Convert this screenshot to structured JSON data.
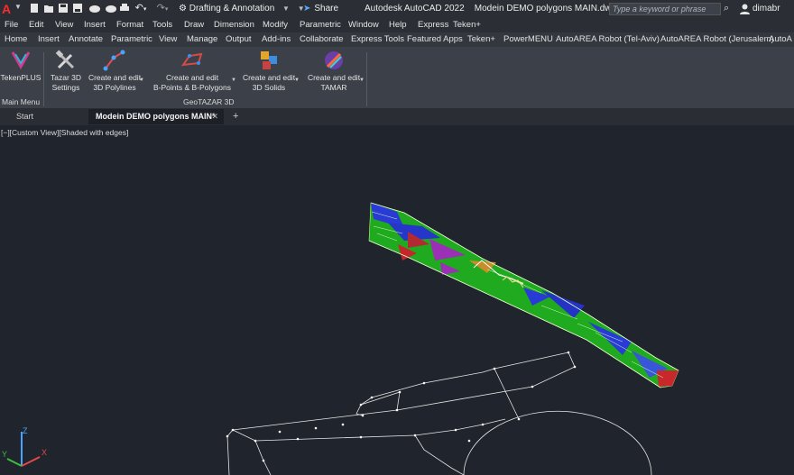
{
  "title_bar": {
    "logo_letter": "A",
    "workspace": "Drafting & Annotation",
    "share_label": "Share",
    "app_title": "Autodesk AutoCAD 2022",
    "file_name": "Modein DEMO polygons MAIN.dwg",
    "search_placeholder": "Type a keyword or phrase",
    "user": "dimabr",
    "icons": [
      "new-file-icon",
      "open-folder-icon",
      "save-icon",
      "save-as-icon",
      "print-icon",
      "undo-icon",
      "redo-icon",
      "gear-icon",
      "share-icon",
      "search-icon",
      "user-icon"
    ]
  },
  "menu_bar": [
    "File",
    "Edit",
    "View",
    "Insert",
    "Format",
    "Tools",
    "Draw",
    "Dimension",
    "Modify",
    "Parametric",
    "Window",
    "Help",
    "Express",
    "Teken+"
  ],
  "ribbon_tabs": [
    "Home",
    "Insert",
    "Annotate",
    "Parametric",
    "View",
    "Manage",
    "Output",
    "Add-ins",
    "Collaborate",
    "Express Tools",
    "Featured Apps",
    "Teken+",
    "PowerMENU",
    "AutoAREA Robot (Tel-Aviv)",
    "AutoAREA Robot (Jerusalem)",
    "AutoA"
  ],
  "ribbon": {
    "buttons": [
      {
        "label1": "TekenPLUS",
        "label2": ""
      },
      {
        "label1": "Tazar 3D",
        "label2": "Settings"
      },
      {
        "label1": "Create and edit",
        "label2": "3D Polylines"
      },
      {
        "label1": "Create and edit",
        "label2": "B-Points & B-Polygons"
      },
      {
        "label1": "Create and edit",
        "label2": "3D Solids"
      },
      {
        "label1": "Create and edit",
        "label2": "TAMAR"
      }
    ],
    "panels": [
      "Main Menu",
      "GeoTAZAR 3D"
    ]
  },
  "doc_tabs": [
    "Start",
    "Modein DEMO polygons MAIN*"
  ],
  "viewport": {
    "view_label": "[−][Custom View][Shaded with edges]",
    "ucs_labels": {
      "z": "Z",
      "y": "Y",
      "x": "X"
    }
  },
  "colors": {
    "accent_red": "#ff2a2a",
    "model_green": "#1fae1f",
    "model_blue": "#2a3ad6",
    "model_purple": "#9b2fb5",
    "model_red": "#c4272b",
    "viewport_bg": "#20242c"
  }
}
